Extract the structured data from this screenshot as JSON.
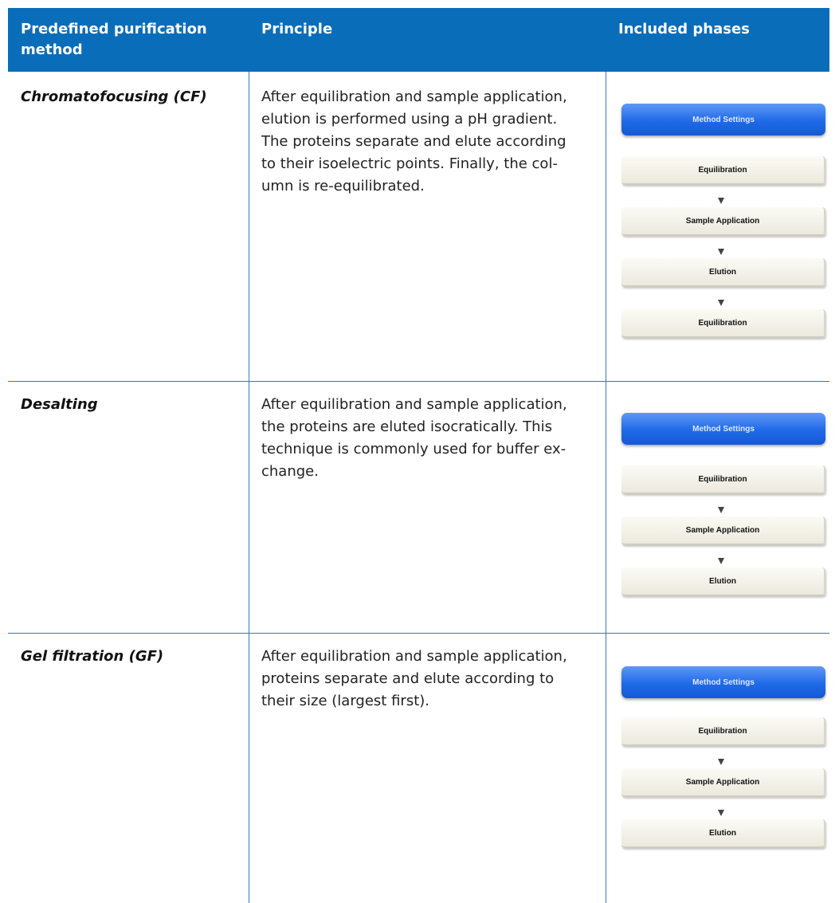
{
  "header": {
    "col1": "Predefined purification method",
    "col2": "Principle",
    "col3": "Included phases"
  },
  "rows": [
    {
      "method": "Chromatofocusing (CF)",
      "principle": [
        "After equilibration and sample application,",
        "elution is performed using a pH gradient.",
        "The proteins separate and elute according",
        "to their isoelectric points. Finally, the col-",
        "umn is re-equilibrated."
      ],
      "settings_label": "Method Settings",
      "phases": [
        "Equilibration",
        "Sample Application",
        "Elution",
        "Equilibration"
      ]
    },
    {
      "method": "Desalting",
      "principle": [
        "After equilibration and sample application,",
        "the proteins are eluted isocratically. This",
        "technique is commonly used for buffer ex-",
        "change."
      ],
      "settings_label": "Method Settings",
      "phases": [
        "Equilibration",
        "Sample Application",
        "Elution"
      ]
    },
    {
      "method": "Gel filtration (GF)",
      "principle": [
        "After equilibration and sample application,",
        "proteins separate and elute according to",
        "their size (largest first)."
      ],
      "settings_label": "Method Settings",
      "phases": [
        "Equilibration",
        "Sample Application",
        "Elution"
      ]
    }
  ]
}
